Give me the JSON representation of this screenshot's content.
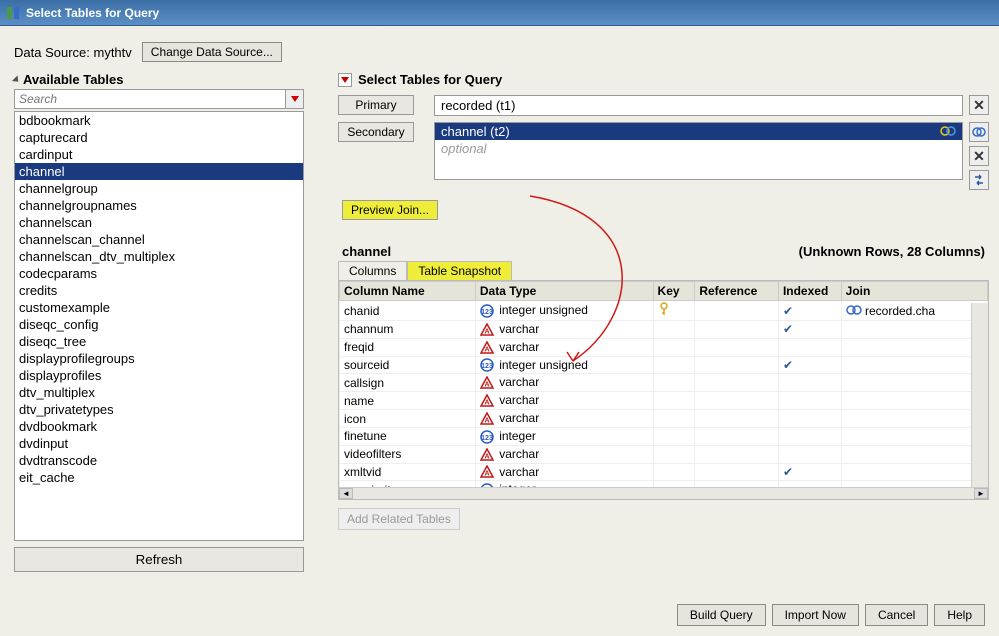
{
  "window": {
    "title": "Select Tables for Query"
  },
  "dataSource": {
    "label": "Data Source: mythtv",
    "changeBtn": "Change Data Source..."
  },
  "left": {
    "heading": "Available Tables",
    "searchPlaceholder": "Search",
    "refreshBtn": "Refresh",
    "tables": [
      "bdbookmark",
      "capturecard",
      "cardinput",
      "channel",
      "channelgroup",
      "channelgroupnames",
      "channelscan",
      "channelscan_channel",
      "channelscan_dtv_multiplex",
      "codecparams",
      "credits",
      "customexample",
      "diseqc_config",
      "diseqc_tree",
      "displayprofilegroups",
      "displayprofiles",
      "dtv_multiplex",
      "dtv_privatetypes",
      "dvdbookmark",
      "dvdinput",
      "dvdtranscode",
      "eit_cache"
    ],
    "selected": "channel"
  },
  "right": {
    "heading": "Select Tables for Query",
    "primaryLabel": "Primary",
    "primaryValue": "recorded (t1)",
    "secondaryLabel": "Secondary",
    "secondarySelected": "channel (t2)",
    "secondaryPlaceholder": "optional",
    "previewBtn": "Preview Join..."
  },
  "detail": {
    "tableName": "channel",
    "rowsCols": "(Unknown Rows, 28 Columns)",
    "tab1": "Columns",
    "tab2": "Table Snapshot",
    "headers": {
      "name": "Column Name",
      "type": "Data Type",
      "key": "Key",
      "ref": "Reference",
      "idx": "Indexed",
      "join": "Join"
    },
    "columns": [
      {
        "name": "chanid",
        "type": "integer unsigned",
        "icon": "int",
        "key": true,
        "indexed": true,
        "join": "recorded.cha"
      },
      {
        "name": "channum",
        "type": "varchar",
        "icon": "str",
        "key": false,
        "indexed": true,
        "join": ""
      },
      {
        "name": "freqid",
        "type": "varchar",
        "icon": "str",
        "key": false,
        "indexed": false,
        "join": ""
      },
      {
        "name": "sourceid",
        "type": "integer unsigned",
        "icon": "int",
        "key": false,
        "indexed": true,
        "join": ""
      },
      {
        "name": "callsign",
        "type": "varchar",
        "icon": "str",
        "key": false,
        "indexed": false,
        "join": ""
      },
      {
        "name": "name",
        "type": "varchar",
        "icon": "str",
        "key": false,
        "indexed": false,
        "join": ""
      },
      {
        "name": "icon",
        "type": "varchar",
        "icon": "str",
        "key": false,
        "indexed": false,
        "join": ""
      },
      {
        "name": "finetune",
        "type": "integer",
        "icon": "int",
        "key": false,
        "indexed": false,
        "join": ""
      },
      {
        "name": "videofilters",
        "type": "varchar",
        "icon": "str",
        "key": false,
        "indexed": false,
        "join": ""
      },
      {
        "name": "xmltvid",
        "type": "varchar",
        "icon": "str",
        "key": false,
        "indexed": true,
        "join": ""
      },
      {
        "name": "recpriority",
        "type": "integer",
        "icon": "int",
        "key": false,
        "indexed": false,
        "join": ""
      }
    ],
    "addRelated": "Add Related Tables"
  },
  "footer": {
    "build": "Build Query",
    "import": "Import Now",
    "cancel": "Cancel",
    "help": "Help"
  }
}
